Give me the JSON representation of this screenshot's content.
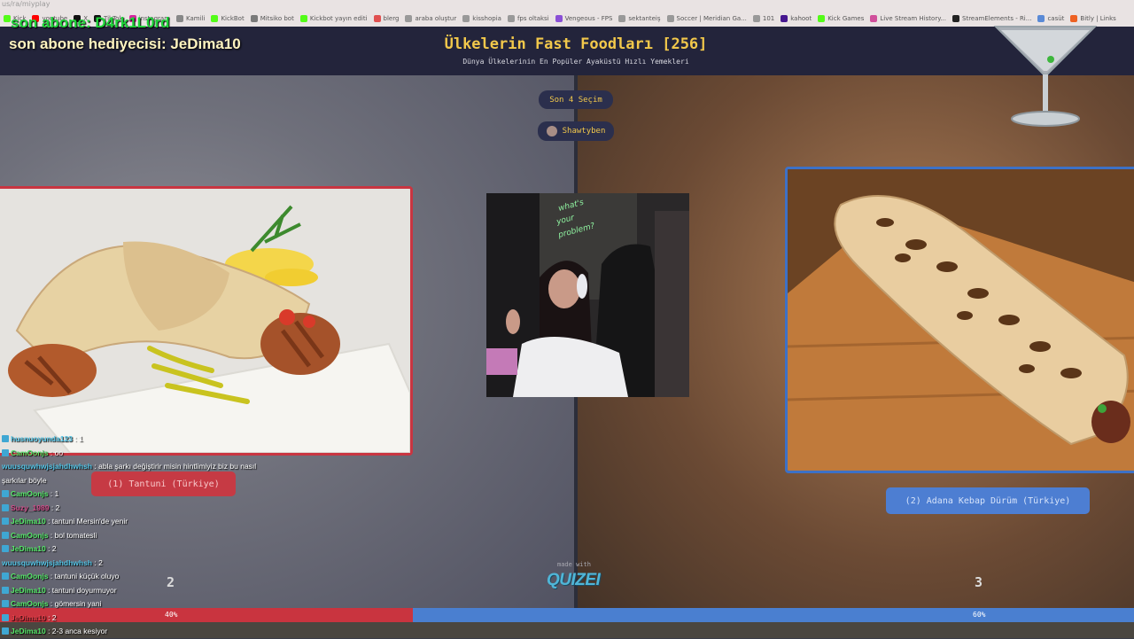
{
  "browser": {
    "url": "us/ra/miyplay",
    "bookmarks": [
      {
        "label": "Kick",
        "icon": "kick-icon",
        "color": "#53fc18"
      },
      {
        "label": "youtube",
        "icon": "youtube-icon",
        "color": "#ff0000"
      },
      {
        "label": "X",
        "icon": "x-icon",
        "color": "#111111"
      },
      {
        "label": "TikTok",
        "icon": "tiktok-icon",
        "color": "#111111"
      },
      {
        "label": "instagram",
        "icon": "instagram-icon",
        "color": "#d6249f"
      },
      {
        "label": "Kamili",
        "icon": "kamili-icon",
        "color": "#888888"
      },
      {
        "label": "KickBot",
        "icon": "kickbot-icon",
        "color": "#53fc18"
      },
      {
        "label": "Mitsiko bot",
        "icon": "bot-icon",
        "color": "#7a7a7a"
      },
      {
        "label": "Kickbot yayın editi",
        "icon": "kickbot-icon",
        "color": "#53fc18"
      },
      {
        "label": "blerg",
        "icon": "heart-icon",
        "color": "#e05050"
      },
      {
        "label": "araba oluştur",
        "icon": "car-icon",
        "color": "#999999"
      },
      {
        "label": "kisshopia",
        "icon": "kiss-icon",
        "color": "#999999"
      },
      {
        "label": "fps oltaksi",
        "icon": "game-icon",
        "color": "#999999"
      },
      {
        "label": "Vengeous - FPS",
        "icon": "vengeous-icon",
        "color": "#8a4fd6"
      },
      {
        "label": "sektanteiş",
        "icon": "site-icon",
        "color": "#999999"
      },
      {
        "label": "Soccer | Meridian Ga...",
        "icon": "soccer-icon",
        "color": "#999999"
      },
      {
        "label": "101",
        "icon": "site-icon",
        "color": "#999999"
      },
      {
        "label": "kahoot",
        "icon": "kahoot-icon",
        "color": "#46178f"
      },
      {
        "label": "Kick Games",
        "icon": "kick-icon",
        "color": "#53fc18"
      },
      {
        "label": "Live Stream History...",
        "icon": "history-icon",
        "color": "#d04f9b"
      },
      {
        "label": "StreamElements - Ri...",
        "icon": "streamelements-icon",
        "color": "#222222"
      },
      {
        "label": "casüt",
        "icon": "link-icon",
        "color": "#5a8ad6"
      },
      {
        "label": "Bitly | Links",
        "icon": "bitly-icon",
        "color": "#ee6123"
      }
    ]
  },
  "overlay": {
    "last_sub": "son abone: D4rk1L0rd",
    "last_gift": "son abone hediyecisi: JeDima10"
  },
  "header": {
    "title": "Ülkelerin Fast Foodları [256]",
    "subtitle": "Dünya Ülkelerinin En Popüler Ayaküstü Hızlı Yemekleri"
  },
  "controls": {
    "last4": "Son 4 Seçim",
    "voter": "Shawtyben"
  },
  "options": {
    "left": {
      "label": "(1) Tantuni (Türkiye)",
      "votes": "2",
      "percent": "40%",
      "share": 40,
      "color": "#c9343f"
    },
    "right": {
      "label": "(2) Adana Kebap Dürüm (Türkiye)",
      "votes": "3",
      "percent": "60%",
      "share": 60,
      "color": "#4a7fd0"
    }
  },
  "webcam": {
    "neon_text": "what's your problem?"
  },
  "branding": {
    "made_with": "made with",
    "logo": "QUIZEI"
  },
  "chat": [
    {
      "user": "husnuoyunda123",
      "message": "1",
      "color": "#56c6e8",
      "badge": true
    },
    {
      "user": "CamOonjs",
      "message": "oo",
      "color": "#56e86a",
      "badge": true
    },
    {
      "user": "wuusquwhwjsjahdhwhsh",
      "message": "abla şarkı değiştirir misin hintlimiyiz biz bu nasıl şarkılar böyle",
      "color": "#56c6e8",
      "badge": false
    },
    {
      "user": "CamOonjs",
      "message": "1",
      "color": "#56e86a",
      "badge": true
    },
    {
      "user": "Suzy_1989",
      "message": "2",
      "color": "#d04d8a",
      "badge": true
    },
    {
      "user": "JeDima10",
      "message": "tantuni Mersin'de yenir",
      "color": "#56e86a",
      "badge": true
    },
    {
      "user": "CamOonjs",
      "message": "bol tomatesli",
      "color": "#56e86a",
      "badge": true
    },
    {
      "user": "JeDima10",
      "message": "2",
      "color": "#56e86a",
      "badge": true
    },
    {
      "user": "wuusquwhwjsjahdhwhsh",
      "message": "2",
      "color": "#56c6e8",
      "badge": false
    },
    {
      "user": "CamOonjs",
      "message": "tantuni küçük oluyo",
      "color": "#56e86a",
      "badge": true
    },
    {
      "user": "JeDima10",
      "message": "tantuni doyurmuyor",
      "color": "#56e86a",
      "badge": true
    },
    {
      "user": "CamOonjs",
      "message": "gömersin yani",
      "color": "#56e86a",
      "badge": true
    },
    {
      "user": "JeDima10",
      "message": "2",
      "color": "#e0404a",
      "badge": true
    },
    {
      "user": "JeDima10",
      "message": "2-3 anca kesiyor",
      "color": "#56e86a",
      "badge": true
    }
  ]
}
